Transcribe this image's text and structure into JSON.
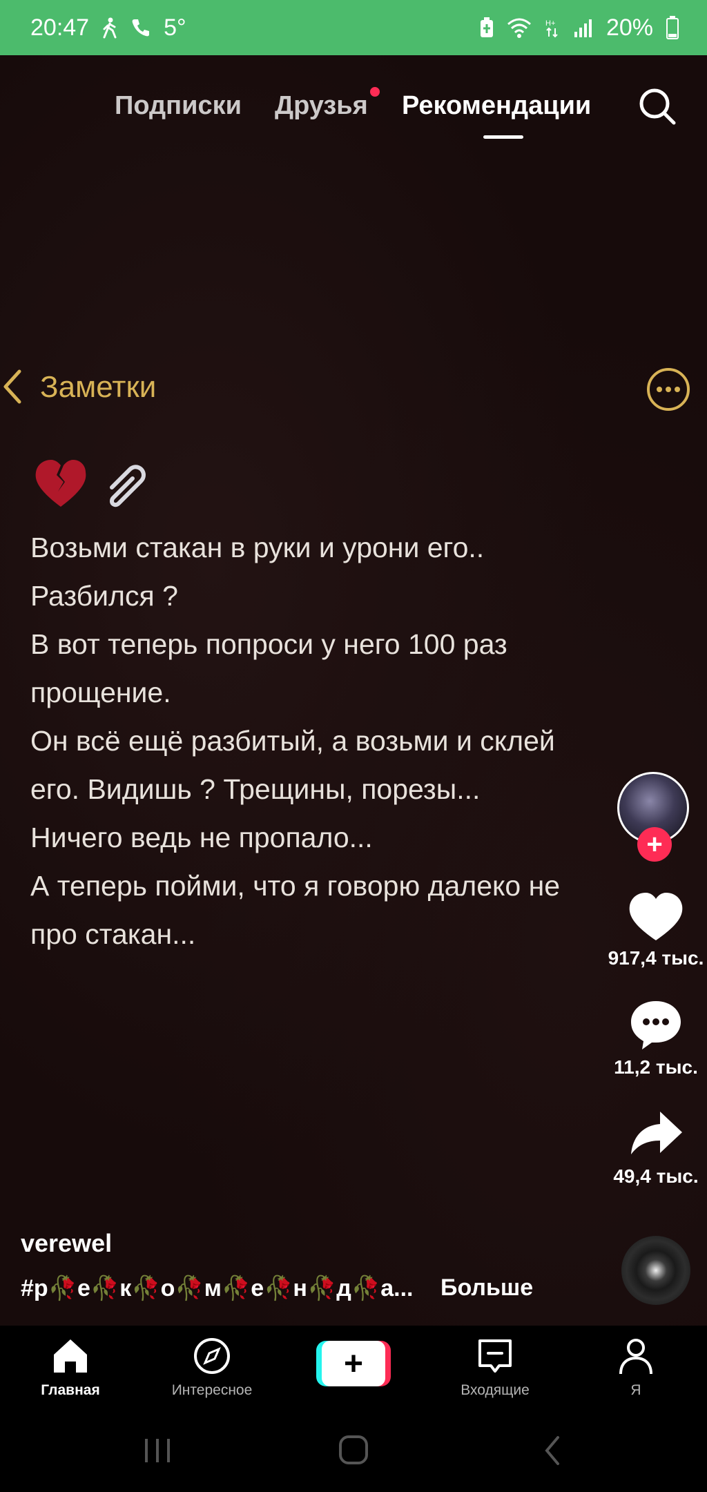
{
  "status_bar": {
    "time": "20:47",
    "temperature": "5°",
    "battery": "20%"
  },
  "top_tabs": {
    "subscriptions": "Подписки",
    "friends": "Друзья",
    "recommendations": "Рекомендации"
  },
  "note": {
    "back_label": "Заметки",
    "emojis": "💔📎",
    "lines": [
      "Возьми стакан в руки и урони его..",
      "Разбился ?",
      "В вот теперь попроси у него 100 раз",
      "прощение.",
      "Он всё ещё разбитый, а возьми и склей",
      "его. Видишь ? Трещины, порезы...",
      "Ничего ведь не пропало...",
      "А теперь пойми, что я говорю далеко не",
      "про стакан..."
    ]
  },
  "right_rail": {
    "likes": "917,4 тыс.",
    "comments": "11,2 тыс.",
    "shares": "49,4 тыс."
  },
  "caption": {
    "author": "verewel",
    "hashtag": "#р🥀е🥀к🥀о🥀м🥀е🥀н🥀д🥀а...",
    "more": "Больше"
  },
  "bottom_nav": {
    "home": "Главная",
    "discover": "Интересное",
    "create": "+",
    "inbox": "Входящие",
    "me": "Я"
  },
  "colors": {
    "status_bar_bg": "#4cbb6c",
    "accent_red": "#fe2c55",
    "notes_gold": "#d8b356"
  }
}
